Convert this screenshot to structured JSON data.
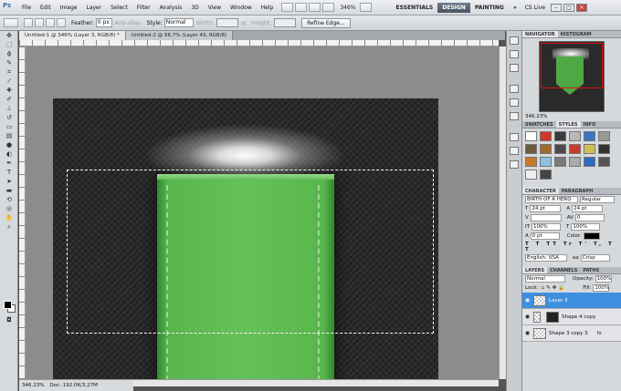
{
  "app": {
    "logo": "Ps",
    "zoom_display": "346%"
  },
  "menu": [
    "File",
    "Edit",
    "Image",
    "Layer",
    "Select",
    "Filter",
    "Analysis",
    "3D",
    "View",
    "Window",
    "Help"
  ],
  "workspaces": [
    "ESSENTIALS",
    "DESIGN",
    "PAINTING"
  ],
  "workspace_more": "»",
  "cs_live": "CS Live",
  "options": {
    "feather_label": "Feather:",
    "feather_value": "0 px",
    "antialias_label": "Anti-alias",
    "style_label": "Style:",
    "style_value": "Normal",
    "width_label": "Width:",
    "height_label": "Height:",
    "refine_edge": "Refine Edge..."
  },
  "tabs": [
    {
      "label": "Untitled-1 @ 346% (Layer 3, RGB/8) *"
    },
    {
      "label": "Untitled-2 @ 66.7% (Layer 43, RGB/8)"
    }
  ],
  "status": {
    "zoom": "346.23%",
    "doc": "Doc: 192.0K/3.27M"
  },
  "navigator": {
    "tabs": [
      "NAVIGATOR",
      "HISTOGRAM"
    ],
    "zoom": "346.23%"
  },
  "styles_panel": {
    "tabs": [
      "SWATCHES",
      "STYLES",
      "INFO"
    ]
  },
  "character": {
    "tabs": [
      "CHARACTER",
      "PARAGRAPH"
    ],
    "font": "BIRTH OF A HERO",
    "style": "Regular",
    "size": "24 pt",
    "leading": "24 pt",
    "tracking": "0",
    "scale_v": "100%",
    "scale_h": "100%",
    "baseline": "0 pt",
    "color_label": "Color:",
    "language": "English: USA",
    "aa_label": "aa",
    "antialias": "Crisp"
  },
  "layers": {
    "tabs": [
      "LAYERS",
      "CHANNELS",
      "PATHS"
    ],
    "blend": "Normal",
    "opacity_label": "Opacity:",
    "opacity": "100%",
    "lock_label": "Lock:",
    "fill_label": "Fill:",
    "fill": "100%",
    "items": [
      {
        "name": "Layer 3"
      },
      {
        "name": "Shape 4 copy"
      },
      {
        "name": "Shape 3 copy 3"
      }
    ]
  },
  "colors": {
    "accent": "#3d8fe0",
    "ribbon": "#65c159",
    "bg_dark": "#2c2a2a"
  }
}
